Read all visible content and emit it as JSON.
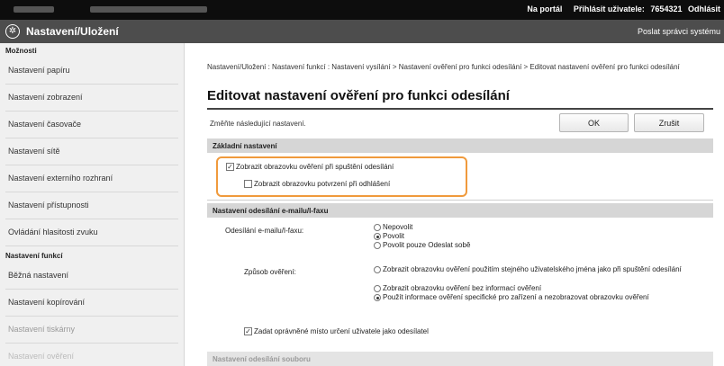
{
  "topbar": {
    "portal": "Na portál",
    "login_user_label": "Přihlásit uživatele:",
    "user_id": "7654321",
    "logout": "Odhlásit"
  },
  "header": {
    "title": "Nastavení/Uložení",
    "admin_mail": "Poslat správci systému"
  },
  "sidebar": {
    "options_heading": "Možnosti",
    "items": [
      "Nastavení papíru",
      "Nastavení zobrazení",
      "Nastavení časovače",
      "Nastavení sítě",
      "Nastavení externího rozhraní",
      "Nastavení přístupnosti",
      "Ovládání hlasitosti zvuku"
    ],
    "function_heading": "Nastavení funkcí",
    "function_items": [
      "Běžná nastavení",
      "Nastavení kopírování",
      "Nastavení tiskárny",
      "Nastavení ověření"
    ]
  },
  "main": {
    "breadcrumb": "Nastavení/Uložení : Nastavení funkcí : Nastavení vysílání > Nastavení ověření pro funkci odesílání > Editovat nastavení ověření pro funkci odesílání",
    "title": "Editovat nastavení ověření pro funkci odesílání",
    "instructions": "Změňte následující nastavení.",
    "ok_button": "OK",
    "cancel_button": "Zrušit",
    "basic_section": "Základní nastavení",
    "show_auth_screen": {
      "label": "Zobrazit obrazovku ověření při spuštění odesílání",
      "checked": true
    },
    "show_logout_confirm": {
      "label": "Zobrazit obrazovku potvrzení při odhlášení",
      "checked": false
    },
    "email_section": "Nastavení odesílání e-mailu/I-faxu",
    "email_send_label": "Odesílání e-mailu/I-faxu:",
    "email_send_options": [
      {
        "label": "Nepovolit",
        "selected": false
      },
      {
        "label": "Povolit",
        "selected": true
      },
      {
        "label": "Povolit pouze Odeslat sobě",
        "selected": false
      }
    ],
    "auth_method_label": "Způsob ověření:",
    "auth_method_options": [
      {
        "label": "Zobrazit obrazovku ověření použitím stejného uživatelského jména jako při spuštění odesílání",
        "selected": false
      },
      {
        "label": "Zobrazit obrazovku ověření bez informací ověření",
        "selected": false
      },
      {
        "label": "Použít informace ověření specifické pro zařízení a nezobrazovat obrazovku ověření",
        "selected": true
      }
    ],
    "sender_checkbox": {
      "label": "Zadat oprávněné místo určení uživatele jako odesílatel",
      "checked": true
    },
    "folder_section": "Nastavení odesílání souboru"
  }
}
